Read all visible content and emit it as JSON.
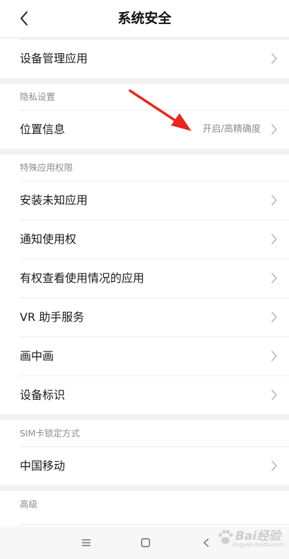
{
  "header": {
    "title": "系统安全",
    "back_icon": "chevron-left-icon"
  },
  "sections": {
    "device": {
      "rows": [
        {
          "label": "设备管理应用",
          "value": ""
        }
      ]
    },
    "privacy": {
      "header": "隐私设置",
      "rows": [
        {
          "label": "位置信息",
          "value": "开启/高精确度"
        }
      ]
    },
    "special": {
      "header": "特殊应用权限",
      "rows": [
        {
          "label": "安装未知应用",
          "value": ""
        },
        {
          "label": "通知使用权",
          "value": ""
        },
        {
          "label": "有权查看使用情况的应用",
          "value": ""
        },
        {
          "label": "VR 助手服务",
          "value": ""
        },
        {
          "label": "画中画",
          "value": ""
        },
        {
          "label": "设备标识",
          "value": ""
        }
      ]
    },
    "sim": {
      "header": "SIM卡锁定方式",
      "rows": [
        {
          "label": "中国移动",
          "value": ""
        }
      ]
    },
    "advanced": {
      "header": "高级"
    }
  },
  "annotation": {
    "color": "#e8261b"
  },
  "navbar": {
    "icons": [
      "menu-icon",
      "home-square-icon",
      "back-triangle-icon"
    ]
  },
  "watermark": {
    "brand": "Bai经验",
    "sub": "jingyan.baidu.com"
  }
}
